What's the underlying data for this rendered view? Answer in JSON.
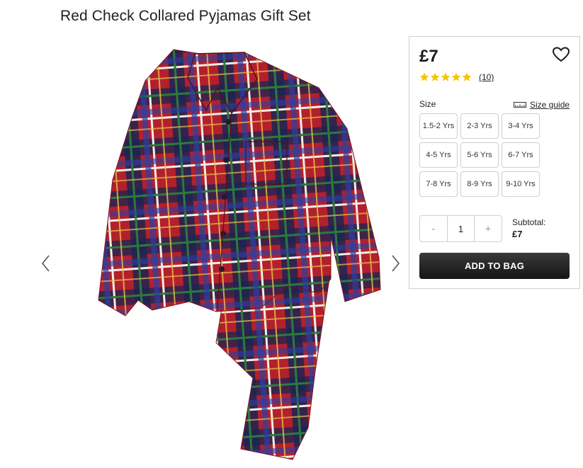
{
  "product": {
    "title": "Red Check Collared Pyjamas Gift Set",
    "image_icon": "plaid-pyjamas-image"
  },
  "gallery": {
    "prev_icon": "chevron-left-icon",
    "next_icon": "chevron-right-icon"
  },
  "panel": {
    "price": "£7",
    "wishlist_icon": "heart-icon",
    "rating_stars": 5,
    "review_count": "(10)",
    "size_label": "Size",
    "size_guide_label": "Size guide",
    "size_guide_icon": "ruler-icon",
    "sizes": [
      "1.5-2 Yrs",
      "2-3 Yrs",
      "3-4 Yrs",
      "4-5 Yrs",
      "5-6 Yrs",
      "6-7 Yrs",
      "7-8 Yrs",
      "8-9 Yrs",
      "9-10 Yrs"
    ],
    "quantity": {
      "minus": "-",
      "value": "1",
      "plus": "+"
    },
    "subtotal_label": "Subtotal:",
    "subtotal_value": "£7",
    "add_to_bag": "ADD TO BAG"
  },
  "colors": {
    "star": "#f5c400",
    "button_bg": "#1f1f1f",
    "plaid_red": "#b8232f",
    "plaid_navy": "#1b2350"
  }
}
